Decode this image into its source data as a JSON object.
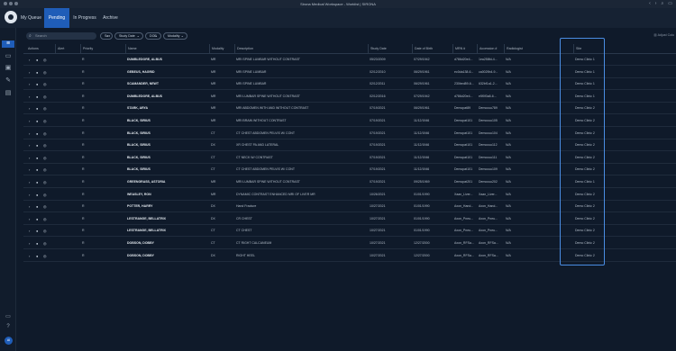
{
  "window": {
    "title": "Sirona Medical Workspace - Worklist | SIRONA"
  },
  "tabs": [
    {
      "label": "My Queue"
    },
    {
      "label": "Pending"
    },
    {
      "label": "In Progress"
    },
    {
      "label": "Archive"
    }
  ],
  "toolbar": {
    "search_placeholder": "Search",
    "filters": [
      {
        "label": "Sex"
      },
      {
        "label": "Study Date"
      },
      {
        "label": "DOB"
      },
      {
        "label": "Modality"
      }
    ],
    "adjust_label": "Adjust Colu"
  },
  "table": {
    "columns": [
      "Actions",
      "Alert",
      "Priority",
      "Name",
      "Modality",
      "Description",
      "Study Date",
      "Date of Birth",
      "MRN #",
      "Accession #",
      "Radiologist",
      "Site"
    ],
    "rows": [
      {
        "priority": "R",
        "name": "DUMBLEDORE, ALBUS",
        "modality": "MR",
        "description": "MRI SPINE LUMBAR WITHOUT CONTRAST",
        "study_date": "05/23/2009",
        "dob": "07/29/1942",
        "mrn": "d786d20e4...",
        "accession": "1ea258fd-4...",
        "radiologist": "N/A",
        "site": "Demo Clinic 1"
      },
      {
        "priority": "R",
        "name": "GEBEUS, HAGRID",
        "modality": "MR",
        "description": "MRI SPINE LUMBAR",
        "study_date": "02/12/2010",
        "dob": "06/29/1961",
        "mrn": "ec0da138-6...",
        "accession": "ca0029b4-9...",
        "radiologist": "N/A",
        "site": "Demo Clinic 1"
      },
      {
        "priority": "R",
        "name": "SCAMANDER, NEWT",
        "modality": "MR",
        "description": "MRI SPINE LUMBAR",
        "study_date": "02/12/2011",
        "dob": "06/29/1961",
        "mrn": "230bed89-6...",
        "accession": "632bf1a1-2...",
        "radiologist": "N/A",
        "site": "Demo Clinic 1"
      },
      {
        "priority": "R",
        "name": "DUMBLEDORE, ALBUS",
        "modality": "MR",
        "description": "MRI LUMBAR SPINE WITHOUT CONTRAST",
        "study_date": "02/12/2016",
        "dob": "07/29/1942",
        "mrn": "d786d20e4...",
        "accession": "e5f0f3a5-6...",
        "radiologist": "N/A",
        "site": "Demo Clinic 1"
      },
      {
        "priority": "R",
        "name": "STARK, ARYA",
        "modality": "MR",
        "description": "MRI ABDOMEN WITH AND WITHOUT CONTRAST",
        "study_date": "07/19/2021",
        "dob": "06/29/1961",
        "mrn": "Demopat89",
        "accession": "Democuu789",
        "radiologist": "N/A",
        "site": "Demo Clinic 2"
      },
      {
        "priority": "R",
        "name": "BLACK, SIRIUS",
        "modality": "MR",
        "description": "MRI BRAIN WITHOUT CONTRAST",
        "study_date": "07/19/2021",
        "dob": "11/12/1946",
        "mrn": "Demopat101",
        "accession": "Democuu105",
        "radiologist": "N/A",
        "site": "Demo Clinic 2"
      },
      {
        "priority": "R",
        "name": "BLACK, SIRIUS",
        "modality": "CT",
        "description": "CT CHEST ABDOMEN PELVIS W/ CONT",
        "study_date": "07/19/2021",
        "dob": "11/12/1946",
        "mrn": "Demopat101",
        "accession": "Democuu104",
        "radiologist": "N/A",
        "site": "Demo Clinic 2"
      },
      {
        "priority": "R",
        "name": "BLACK, SIRIUS",
        "modality": "DX",
        "description": "XR CHEST PA AND LATERAL",
        "study_date": "07/19/2021",
        "dob": "11/12/1946",
        "mrn": "Demopat101",
        "accession": "Democuu112",
        "radiologist": "N/A",
        "site": "Demo Clinic 2"
      },
      {
        "priority": "R",
        "name": "BLACK, SIRIUS",
        "modality": "CT",
        "description": "CT NECK W/ CONTRAST",
        "study_date": "07/19/2021",
        "dob": "11/12/1946",
        "mrn": "Demopat101",
        "accession": "Democuu111",
        "radiologist": "N/A",
        "site": "Demo Clinic 2"
      },
      {
        "priority": "R",
        "name": "BLACK, SIRIUS",
        "modality": "CT",
        "description": "CT CHEST ABDOMEN PELVIS W/ CONT",
        "study_date": "07/19/2021",
        "dob": "11/12/1946",
        "mrn": "Demopat101",
        "accession": "Democuu109",
        "radiologist": "N/A",
        "site": "Demo Clinic 2"
      },
      {
        "priority": "R",
        "name": "GREENGRASS, ASTORIA",
        "modality": "MR",
        "description": "MRI LUMBAR SPINE WITHOUT CONTRAST",
        "study_date": "07/19/2021",
        "dob": "09/25/1969",
        "mrn": "Demopat201",
        "accession": "Democuu202",
        "radiologist": "N/A",
        "site": "Demo Clinic 1"
      },
      {
        "priority": "R",
        "name": "WEASLEY, RON",
        "modality": "MR",
        "description": "DYNAMIC CONTRAST ENHANCED MRI OF LIVER MR",
        "study_date": "10/26/2021",
        "dob": "01/01/1990",
        "mrn": "Xaan_Liver...",
        "accession": "Xaan_Liver...",
        "radiologist": "N/A",
        "site": "Demo Clinic 2"
      },
      {
        "priority": "R",
        "name": "POTTER, HARRY",
        "modality": "DX",
        "description": "Hand Fracture",
        "study_date": "10/27/2021",
        "dob": "01/01/1990",
        "mrn": "Axon_Hand...",
        "accession": "Axon_Hand...",
        "radiologist": "N/A",
        "site": "Demo Clinic 2"
      },
      {
        "priority": "R",
        "name": "LESTRANGE, BELLATRIX",
        "modality": "DX",
        "description": "CR CHEST",
        "study_date": "10/27/2021",
        "dob": "01/01/1990",
        "mrn": "Axon_Pneu...",
        "accession": "Axon_Pneu...",
        "radiologist": "N/A",
        "site": "Demo Clinic 2"
      },
      {
        "priority": "R",
        "name": "LESTRANGE, BELLATRIX",
        "modality": "CT",
        "description": "CT CHEST",
        "study_date": "10/27/2021",
        "dob": "01/01/1990",
        "mrn": "Axon_Pneu...",
        "accession": "Axon_Pneu...",
        "radiologist": "N/A",
        "site": "Demo Clinic 2"
      },
      {
        "priority": "R",
        "name": "DOBSON, DOBBY",
        "modality": "CT",
        "description": "CT RIGHT CALCANEUM",
        "study_date": "10/27/2021",
        "dob": "12/27/2000",
        "mrn": "Axon_RFSa...",
        "accession": "Axon_RFSa...",
        "radiologist": "N/A",
        "site": "Demo Clinic 2"
      },
      {
        "priority": "R",
        "name": "DOBSON, DOBBY",
        "modality": "DX",
        "description": "RIGHT HEEL",
        "study_date": "10/27/2021",
        "dob": "12/27/2000",
        "mrn": "Axon_RFSa...",
        "accession": "Axon_RFSa...",
        "radiologist": "N/A",
        "site": "Demo Clinic 2"
      }
    ]
  },
  "user": {
    "initials": "AI"
  }
}
